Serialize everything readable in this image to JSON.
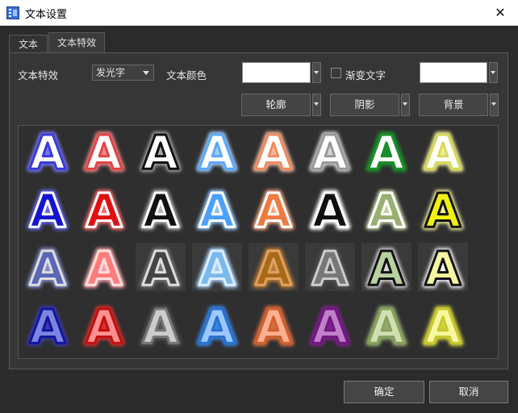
{
  "window": {
    "title": "文本设置",
    "close_glyph": "✕"
  },
  "tabs": [
    {
      "label": "文本"
    },
    {
      "label": "文本特效",
      "active": true
    }
  ],
  "controls": {
    "effect_label": "文本特效",
    "effect_select_value": "发光字",
    "color_label": "文本颜色",
    "text_color": "#ffffff",
    "gradient_checkbox_label": "渐变文字",
    "gradient_checked": false,
    "gradient_color": "#ffffff",
    "outline_button": "轮廓",
    "shadow_button": "阴影",
    "background_button": "背景"
  },
  "effects": {
    "glyph": "A",
    "rows": [
      [
        {
          "fill": "#ffffff",
          "stroke": "#3b3bd6",
          "glow": "#7a7aff",
          "bg": "none"
        },
        {
          "fill": "#ffffff",
          "stroke": "#e04545",
          "glow": "#ff8a8a",
          "bg": "none"
        },
        {
          "fill": "#ffffff",
          "stroke": "#111111",
          "glow": "#aaaaaa",
          "bg": "none"
        },
        {
          "fill": "#ffffff",
          "stroke": "#5aa8ff",
          "glow": "#a8d4ff",
          "bg": "none"
        },
        {
          "fill": "#ffffff",
          "stroke": "#f08a60",
          "glow": "#ffc1a3",
          "bg": "none"
        },
        {
          "fill": "#ffffff",
          "stroke": "#999999",
          "glow": "#dddddd",
          "bg": "none"
        },
        {
          "fill": "#ffffff",
          "stroke": "#1a8f2a",
          "glow": "#1a8f2a",
          "bg": "none"
        },
        {
          "fill": "#ffffff",
          "stroke": "#d8d85a",
          "glow": "#f6f69a",
          "bg": "none"
        }
      ],
      [
        {
          "fill": "#1414d0",
          "stroke": "#ffffff",
          "glow": "#6a6aff",
          "bg": "none"
        },
        {
          "fill": "#e01010",
          "stroke": "#ffffff",
          "glow": "#ff7070",
          "bg": "none"
        },
        {
          "fill": "#111111",
          "stroke": "#ffffff",
          "glow": "#bbbbbb",
          "bg": "none"
        },
        {
          "fill": "#4aa0ff",
          "stroke": "#ffffff",
          "glow": "#8ec8ff",
          "bg": "none"
        },
        {
          "fill": "#f07a40",
          "stroke": "#ffffff",
          "glow": "#ffb088",
          "bg": "none"
        },
        {
          "fill": "#111111",
          "stroke": "#ffffff",
          "glow": "#ffffff",
          "bg": "none"
        },
        {
          "fill": "#98b070",
          "stroke": "#ffffff",
          "glow": "#c8d8a8",
          "bg": "none"
        },
        {
          "fill": "#f0f010",
          "stroke": "#111111",
          "glow": "#f8f8a0",
          "bg": "none"
        }
      ],
      [
        {
          "fill": "#5a66b8",
          "stroke": "#dddddd",
          "glow": "#8890d0",
          "bg": "none"
        },
        {
          "fill": "#ff7a7a",
          "stroke": "#ffdddd",
          "glow": "#ffaaaa",
          "bg": "none"
        },
        {
          "fill": "#444444",
          "stroke": "#dddddd",
          "glow": "#777777",
          "bg": "#3a3a3a"
        },
        {
          "fill": "#7ab8f0",
          "stroke": "#ddeeff",
          "glow": "#a8d4ff",
          "bg": "#3a3a3a"
        },
        {
          "fill": "#a86a18",
          "stroke": "#e0a060",
          "glow": "#c08030",
          "bg": "#3a3a3a"
        },
        {
          "fill": "#777777",
          "stroke": "#cccccc",
          "glow": "#555555",
          "bg": "#3a3a3a"
        },
        {
          "fill": "#b8d0a0",
          "stroke": "#111111",
          "glow": "#e0e0e0",
          "bg": "#3a3a3a"
        },
        {
          "fill": "#f6f6a0",
          "stroke": "#111111",
          "glow": "#ffffff",
          "bg": "#3a3a3a"
        }
      ],
      [
        {
          "fill": "#7a86e0",
          "stroke": "#1414a0",
          "glow": "#3a3ab0",
          "bg": "none"
        },
        {
          "fill": "#ff9090",
          "stroke": "#c01010",
          "glow": "#e03030",
          "bg": "none"
        },
        {
          "fill": "#cccccc",
          "stroke": "#777777",
          "glow": "#555555",
          "bg": "none"
        },
        {
          "fill": "#9ac8ff",
          "stroke": "#2a70d0",
          "glow": "#3a88e8",
          "bg": "none"
        },
        {
          "fill": "#ffb090",
          "stroke": "#d06030",
          "glow": "#e07040",
          "bg": "none"
        },
        {
          "fill": "#c080c8",
          "stroke": "#701880",
          "glow": "#802090",
          "bg": "none"
        },
        {
          "fill": "#d0e0b0",
          "stroke": "#88a060",
          "glow": "#98b070",
          "bg": "none"
        },
        {
          "fill": "#f8f8a0",
          "stroke": "#c8c830",
          "glow": "#d8d840",
          "bg": "none"
        }
      ]
    ]
  },
  "footer": {
    "ok_button": "确定",
    "cancel_button": "取消"
  }
}
